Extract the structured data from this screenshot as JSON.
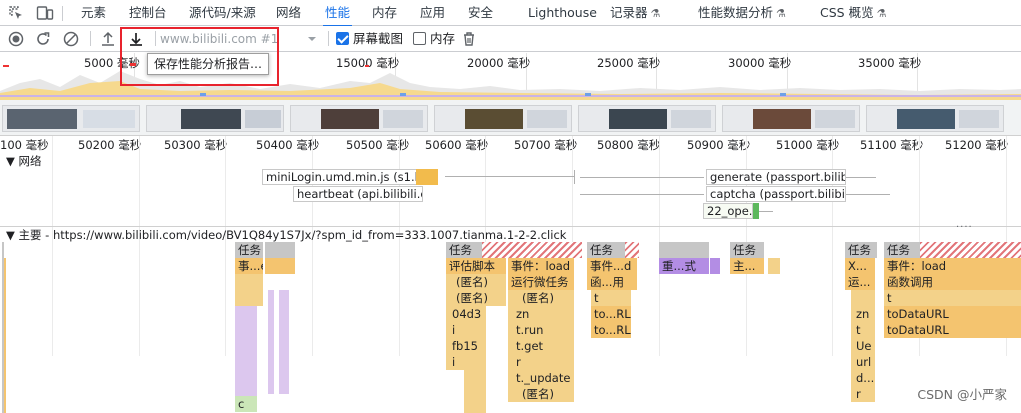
{
  "tabs": [
    {
      "label": "元素",
      "active": false
    },
    {
      "label": "控制台",
      "active": false
    },
    {
      "label": "源代码/来源",
      "active": false
    },
    {
      "label": "网络",
      "active": false
    },
    {
      "label": "性能",
      "active": true
    },
    {
      "label": "内存",
      "active": false
    },
    {
      "label": "应用",
      "active": false
    },
    {
      "label": "安全",
      "active": false
    },
    {
      "label": "Lighthouse",
      "active": false
    },
    {
      "label": "记录器",
      "active": false,
      "experimental": true
    },
    {
      "label": "性能数据分析",
      "active": false,
      "experimental": true
    },
    {
      "label": "CSS 概览",
      "active": false,
      "experimental": true
    }
  ],
  "toolbar": {
    "url_selected": "www.bilibili.com #1",
    "screenshots_label": "屏幕截图",
    "screenshots_checked": true,
    "memory_label": "内存",
    "memory_checked": false,
    "save_tooltip": "保存性能分析报告…",
    "icons": [
      "inspect-icon",
      "device-toggle-icon",
      "record-icon",
      "reload-icon",
      "clear-icon",
      "upload-icon",
      "download-icon",
      "dropdown-icon",
      "trash-icon"
    ]
  },
  "overview": {
    "labels": [
      "5000 毫秒",
      "15000 毫秒",
      "20000 毫秒",
      "25000 毫秒",
      "30000 毫秒",
      "35000 毫秒"
    ]
  },
  "ruler": {
    "labels": [
      "100 毫秒",
      "50200 毫秒",
      "50300 毫秒",
      "50400 毫秒",
      "50500 毫秒",
      "50600 毫秒",
      "50700 毫秒",
      "50800 毫秒",
      "50900 毫秒",
      "51000 毫秒",
      "51100 毫秒",
      "51200 毫秒"
    ]
  },
  "network": {
    "track_label": "▼ 网络",
    "requests": [
      "miniLogin.umd.min.js (s1.hdslb.c...",
      "heartbeat (api.bilibili.com)",
      "generate (passport.bilibili....",
      "captcha (passport.bilibili....",
      "22_ope..."
    ]
  },
  "main": {
    "title": "▼ 主要 - https://www.bilibili.com/video/BV1Q84y1S7Jx/?spm_id_from=333.1007.tianma.1-2-2.click",
    "labels": {
      "task": "任务",
      "evt_e": "事...e",
      "eval_script": "评估脚本",
      "event_load": "事件：load",
      "event_d": "事件...d",
      "recalc": "重...式",
      "main_short": "主...",
      "x_short": "X...",
      "run_microtasks": "运行微任务",
      "func_short": "函...用",
      "run_short": "运...",
      "func_call": "函数调用",
      "anon": "(匿名)",
      "t": "t",
      "c": "c",
      "d04d3": "04d3",
      "zn": "zn",
      "torl": "to...RL",
      "todataurl": "toDataURL",
      "i": "i",
      "t_run": "t.run",
      "fb15": "fb15",
      "t_get": "t.get",
      "ue": "Ue",
      "r": "r",
      "url": "url",
      "t_update": "t._update",
      "d_short": "d..."
    }
  },
  "watermark": "CSDN @小严家"
}
